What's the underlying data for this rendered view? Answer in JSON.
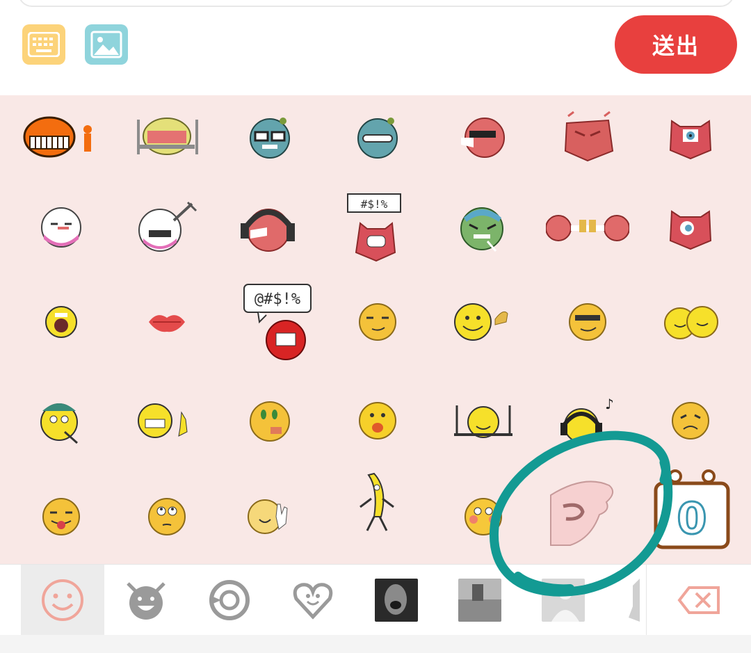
{
  "toolbar": {
    "keyboard_icon": "keyboard-icon",
    "image_icon": "image-icon",
    "send_label": "送出",
    "colors": {
      "keyboard": "#fcd37a",
      "image": "#8fd4dc",
      "send": "#e8403e"
    }
  },
  "emoji_panel": {
    "background": "#f9e8e6",
    "rows": [
      [
        "orange-grin-thumbs-emoji",
        "lemon-eating-emoji",
        "blue-nerd-emoji",
        "blue-shy-emoji",
        "red-sunglasses-emoji",
        "red-angry-emoji",
        "red-eye-cat-emoji"
      ],
      [
        "white-blush-emoji",
        "white-fork-emoji",
        "red-headphones-emoji",
        "red-swearing-cat-emoji",
        "green-sick-emoji",
        "red-cheers-emoji",
        "red-cat-wink-emoji"
      ],
      [
        "yellow-shout-emoji",
        "red-lips-emoji",
        "red-swearing-emoji",
        "yellow-smirk-emoji",
        "yellow-thumbs-emoji",
        "yellow-cool-emoji",
        "yellow-hug-emoji"
      ],
      [
        "yellow-hat-emoji",
        "yellow-grin-ok-emoji",
        "yellow-eyes-emoji",
        "yellow-tongue-emoji",
        "yellow-eat-emoji",
        "yellow-music-emoji",
        "yellow-sad-emoji"
      ],
      [
        "yellow-tongue-out-emoji",
        "yellow-rolleyes-emoji",
        "yellow-wave-emoji",
        "dancing-banana-emoji",
        "yellow-blush-emoji",
        "pink-ok-hand-emoji",
        "zero-sign-emoji"
      ]
    ],
    "zero_sign_text": "0",
    "swear_text_1": "#$!%",
    "swear_text_2": "@#$!%"
  },
  "categories": [
    {
      "name": "smiley-category",
      "active": true
    },
    {
      "name": "devil-category",
      "active": false
    },
    {
      "name": "rotate-category",
      "active": false
    },
    {
      "name": "heart-category",
      "active": false
    },
    {
      "name": "photo-sticker-1",
      "active": false
    },
    {
      "name": "photo-sticker-2",
      "active": false
    },
    {
      "name": "photo-sticker-3",
      "active": false
    },
    {
      "name": "partial-sticker",
      "active": false
    }
  ],
  "delete_icon": "backspace-icon",
  "annotation": {
    "color": "#139a93",
    "shape": "hand-drawn-circle"
  }
}
